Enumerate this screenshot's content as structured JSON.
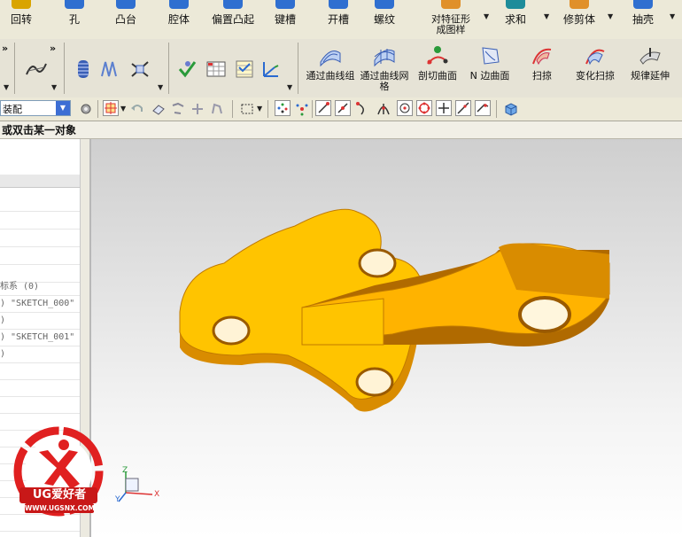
{
  "feature_toolbar": {
    "items": [
      {
        "label": "回转",
        "color": "#d9a400"
      },
      {
        "label": "孔",
        "color": "#2f6fd0"
      },
      {
        "label": "凸台",
        "color": "#2f6fd0"
      },
      {
        "label": "腔体",
        "color": "#2f6fd0"
      },
      {
        "label": "偏置凸起",
        "color": "#2f6fd0"
      },
      {
        "label": "键槽",
        "color": "#2f6fd0"
      },
      {
        "label": "开槽",
        "color": "#2f6fd0"
      },
      {
        "label": "螺纹",
        "color": "#2f6fd0"
      },
      {
        "label": "对特征形成图样",
        "color": "#e0902a"
      },
      {
        "label": "求和",
        "color": "#1e8c9a"
      },
      {
        "label": "修剪体",
        "color": "#e0902a"
      },
      {
        "label": "抽壳",
        "color": "#2f6fd0"
      }
    ]
  },
  "surface_toolbar": {
    "items": [
      {
        "label": "通过曲线组"
      },
      {
        "label": "通过曲线网格"
      },
      {
        "label": "剖切曲面"
      },
      {
        "label": "N 边曲面"
      },
      {
        "label": "扫掠"
      },
      {
        "label": "变化扫掠"
      },
      {
        "label": "规律延伸"
      }
    ]
  },
  "selection_bar": {
    "filter_value": "装配"
  },
  "status": {
    "prompt": "或双击某一对象"
  },
  "navigator": {
    "rows": [
      "标系 (0)",
      ") \"SKETCH_000\"",
      ")",
      ") \"SKETCH_001\"",
      ")"
    ]
  },
  "watermark": {
    "brand": "UG爱好者",
    "url": "WWW.UGSNX.COM"
  },
  "triad": {
    "x": "X",
    "y": "Y",
    "z": "Z"
  },
  "colors": {
    "part_face": "#ffc400",
    "part_side": "#d98c00",
    "part_shadow": "#b06a00"
  }
}
